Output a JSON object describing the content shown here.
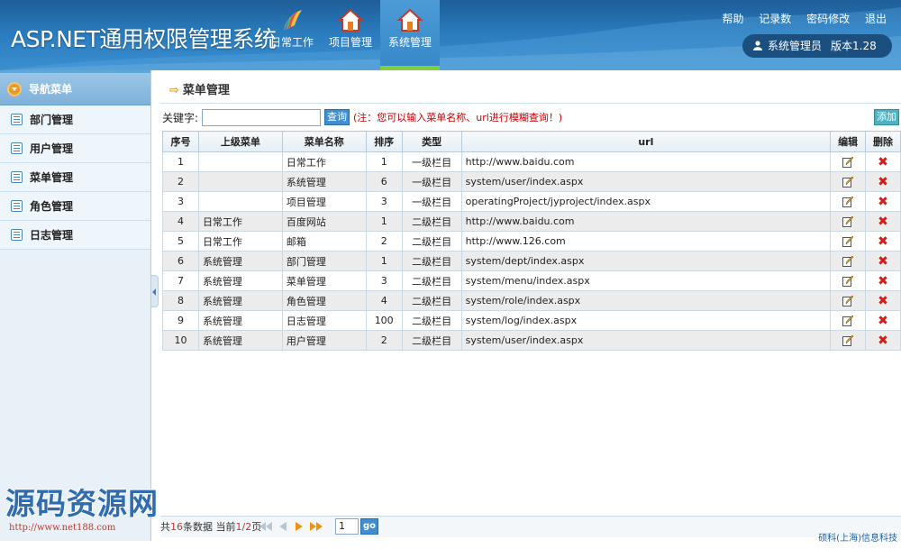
{
  "header": {
    "app_title": "ASP.NET通用权限管理系统",
    "nav": [
      {
        "label": "日常工作",
        "icon": "pen-fan-icon",
        "active": false
      },
      {
        "label": "项目管理",
        "icon": "home-icon",
        "active": false
      },
      {
        "label": "系统管理",
        "icon": "home-icon",
        "active": true
      }
    ],
    "links": [
      "帮助",
      "记录数",
      "密码修改",
      "退出"
    ],
    "user_name": "系统管理员",
    "version": "版本1.28"
  },
  "sidebar": {
    "title": "导航菜单",
    "items": [
      {
        "label": "部门管理"
      },
      {
        "label": "用户管理"
      },
      {
        "label": "菜单管理"
      },
      {
        "label": "角色管理"
      },
      {
        "label": "日志管理"
      }
    ]
  },
  "main": {
    "title": "菜单管理",
    "search_label": "关键字:",
    "search_value": "",
    "search_button": "查询",
    "hint": "(注：您可以输入菜单名称、url进行模糊查询！)",
    "add_button": "添加",
    "table": {
      "headers": [
        "序号",
        "上级菜单",
        "菜单名称",
        "排序",
        "类型",
        "url",
        "编辑",
        "删除"
      ],
      "rows": [
        {
          "no": "1",
          "parent": "",
          "name": "日常工作",
          "sort": "1",
          "type": "一级栏目",
          "url": "http://www.baidu.com"
        },
        {
          "no": "2",
          "parent": "",
          "name": "系统管理",
          "sort": "6",
          "type": "一级栏目",
          "url": "system/user/index.aspx"
        },
        {
          "no": "3",
          "parent": "",
          "name": "项目管理",
          "sort": "3",
          "type": "一级栏目",
          "url": "operatingProject/jyproject/index.aspx"
        },
        {
          "no": "4",
          "parent": "日常工作",
          "name": "百度网站",
          "sort": "1",
          "type": "二级栏目",
          "url": "http://www.baidu.com"
        },
        {
          "no": "5",
          "parent": "日常工作",
          "name": "邮箱",
          "sort": "2",
          "type": "二级栏目",
          "url": "http://www.126.com"
        },
        {
          "no": "6",
          "parent": "系统管理",
          "name": "部门管理",
          "sort": "1",
          "type": "二级栏目",
          "url": "system/dept/index.aspx"
        },
        {
          "no": "7",
          "parent": "系统管理",
          "name": "菜单管理",
          "sort": "3",
          "type": "二级栏目",
          "url": "system/menu/index.aspx"
        },
        {
          "no": "8",
          "parent": "系统管理",
          "name": "角色管理",
          "sort": "4",
          "type": "二级栏目",
          "url": "system/role/index.aspx"
        },
        {
          "no": "9",
          "parent": "系统管理",
          "name": "日志管理",
          "sort": "100",
          "type": "二级栏目",
          "url": "system/log/index.aspx"
        },
        {
          "no": "10",
          "parent": "系统管理",
          "name": "用户管理",
          "sort": "2",
          "type": "二级栏目",
          "url": "system/user/index.aspx"
        }
      ]
    }
  },
  "pager": {
    "prefix": "共",
    "total": "16",
    "mid": "条数据 当前",
    "page": "1/2",
    "suffix": "页",
    "page_input": "1",
    "go": "go"
  },
  "footer": {
    "company": "硕科(上海)信息科技"
  },
  "watermark": {
    "title": "源码资源网",
    "url": "http://www.net188.com"
  },
  "colors": {
    "header_blue": "#2a7bbd",
    "active_underline": "#7fcf3a",
    "hint_red": "#c80000",
    "delete_red": "#d21d1d"
  }
}
